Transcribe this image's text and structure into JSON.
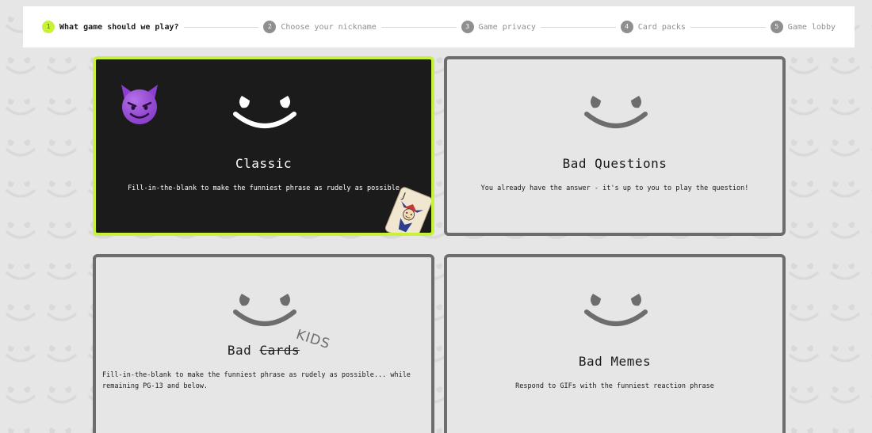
{
  "stepper": {
    "steps": [
      {
        "num": "1",
        "label": "What game should we play?"
      },
      {
        "num": "2",
        "label": "Choose your nickname"
      },
      {
        "num": "3",
        "label": "Game privacy"
      },
      {
        "num": "4",
        "label": "Card packs"
      },
      {
        "num": "5",
        "label": "Game lobby"
      }
    ]
  },
  "cards": {
    "classic": {
      "title": "Classic",
      "desc": "Fill-in-the-blank to make the funniest phrase as rudely as possible"
    },
    "questions": {
      "title": "Bad Questions",
      "desc": "You already have the answer - it's up to you to play the question!"
    },
    "kids": {
      "title_prefix": "Bad",
      "title_struck": "Cards",
      "badge": "KIDS",
      "desc": "Fill-in-the-blank to make the funniest phrase as rudely as possible... while remaining PG-13 and below."
    },
    "memes": {
      "title": "Bad Memes",
      "desc": "Respond to GIFs with the funniest reaction phrase"
    }
  },
  "colors": {
    "accent": "#c8f23a",
    "card_border": "#6d6d6d",
    "selected_bg": "#1b1b1b",
    "background": "#e6e6e6"
  },
  "icons": [
    "smiley-face-icon",
    "devil-emoji-icon",
    "joker-card-icon"
  ]
}
